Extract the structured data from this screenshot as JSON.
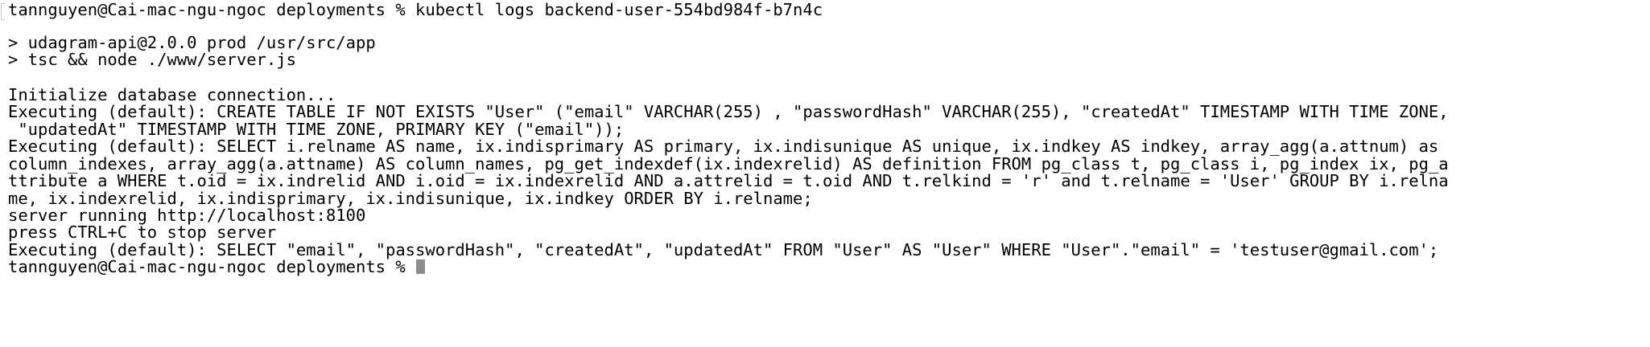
{
  "terminal": {
    "prompt_command": "tannguyen@Cai-mac-ngu-ngoc deployments % kubectl logs backend-user-554bd984f-b7n4c",
    "npm_script_line": "> udagram-api@2.0.0 prod /usr/src/app",
    "npm_command_line": "> tsc && node ./www/server.js",
    "init_line": "Initialize database connection...",
    "create_table_line_1": "Executing (default): CREATE TABLE IF NOT EXISTS \"User\" (\"email\" VARCHAR(255) , \"passwordHash\" VARCHAR(255), \"createdAt\" TIMESTAMP WITH TIME ZONE,",
    "create_table_line_2": " \"updatedAt\" TIMESTAMP WITH TIME ZONE, PRIMARY KEY (\"email\"));",
    "select_index_line_1": "Executing (default): SELECT i.relname AS name, ix.indisprimary AS primary, ix.indisunique AS unique, ix.indkey AS indkey, array_agg(a.attnum) as",
    "select_index_line_2": "column_indexes, array_agg(a.attname) AS column_names, pg_get_indexdef(ix.indexrelid) AS definition FROM pg_class t, pg_class i, pg_index ix, pg_a",
    "select_index_line_3": "ttribute a WHERE t.oid = ix.indrelid AND i.oid = ix.indexrelid AND a.attrelid = t.oid AND t.relkind = 'r' and t.relname = 'User' GROUP BY i.relna",
    "select_index_line_4": "me, ix.indexrelid, ix.indisprimary, ix.indisunique, ix.indkey ORDER BY i.relname;",
    "server_running_line": "server running http://localhost:8100",
    "stop_hint_line": "press CTRL+C to stop server",
    "select_user_line": "Executing (default): SELECT \"email\", \"passwordHash\", \"createdAt\", \"updatedAt\" FROM \"User\" AS \"User\" WHERE \"User\".\"email\" = 'testuser@gmail.com';",
    "final_prompt": "tannguyen@Cai-mac-ngu-ngoc deployments % "
  }
}
